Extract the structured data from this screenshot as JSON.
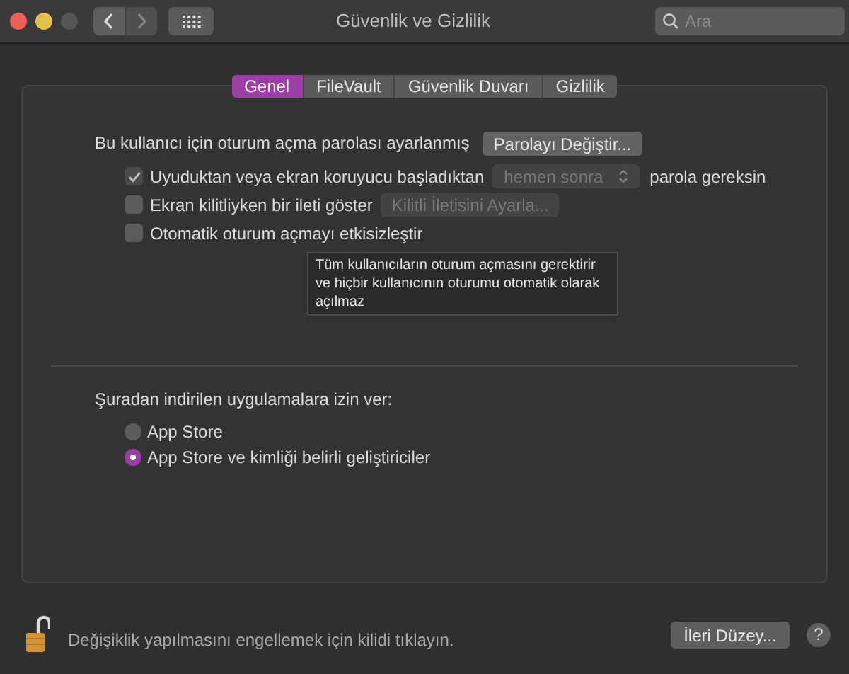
{
  "window": {
    "title": "Güvenlik ve Gizlilik"
  },
  "search": {
    "placeholder": "Ara"
  },
  "tabs": [
    {
      "label": "Genel",
      "selected": true
    },
    {
      "label": "FileVault",
      "selected": false
    },
    {
      "label": "Güvenlik Duvarı",
      "selected": false
    },
    {
      "label": "Gizlilik",
      "selected": false
    }
  ],
  "login_password": {
    "label": "Bu kullanıcı için oturum açma parolası ayarlanmış",
    "button": "Parolayı Değiştir..."
  },
  "options": [
    {
      "kind": "select",
      "checked": true,
      "label": "Uyuduktan veya ekran koruyucu başladıktan",
      "select": {
        "value": "hemen sonra",
        "disabled": true
      },
      "suffix": "parola gereksin"
    },
    {
      "kind": "button",
      "checked": false,
      "label": "Ekran kilitliyken bir ileti göster",
      "button": {
        "label": "Kilitli İletisini Ayarla...",
        "disabled": true
      }
    },
    {
      "kind": "plain",
      "checked": false,
      "label": "Otomatik oturum açmayı etkisizleştir"
    }
  ],
  "tooltip": "Tüm kullanıcıların oturum açmasını gerektirir ve hiçbir kullanıcının oturumu otomatik olarak açılmaz",
  "downloads": {
    "heading": "Şuradan indirilen uygulamalara izin ver:",
    "options": [
      {
        "label": "App Store",
        "selected": false
      },
      {
        "label": "App Store ve kimliği belirli geliştiriciler",
        "selected": true
      }
    ]
  },
  "footer": {
    "lock_text": "Değişiklik yapılmasını engellemek için kilidi tıklayın.",
    "button": "İleri Düzey...",
    "help": "?"
  }
}
